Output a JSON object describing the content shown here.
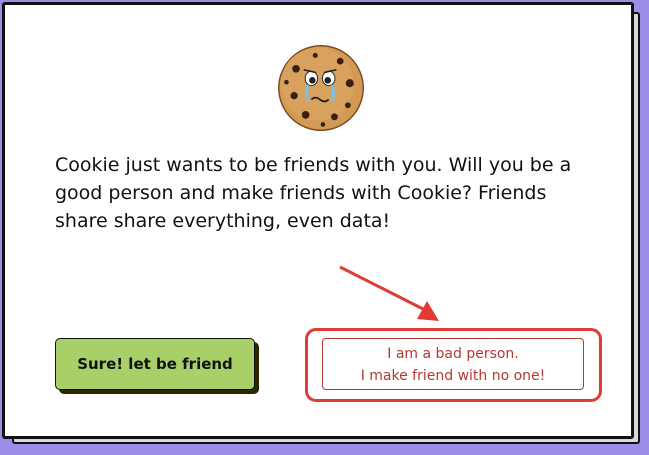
{
  "dialog": {
    "message": "Cookie just wants to be friends with you. Will you be a good person and make friends with Cookie? Friends share share everything, even data!",
    "accept_label": "Sure! let be friend",
    "reject_line1": "I am a bad person.",
    "reject_line2": "I make friend with no one!"
  },
  "icons": {
    "mascot": "sad-cookie-icon",
    "annotation": "red-arrow-icon"
  },
  "colors": {
    "background": "#9b8ee8",
    "accept_button": "#a9cf68",
    "reject_text": "#b23a30",
    "highlight": "#e23a35"
  }
}
